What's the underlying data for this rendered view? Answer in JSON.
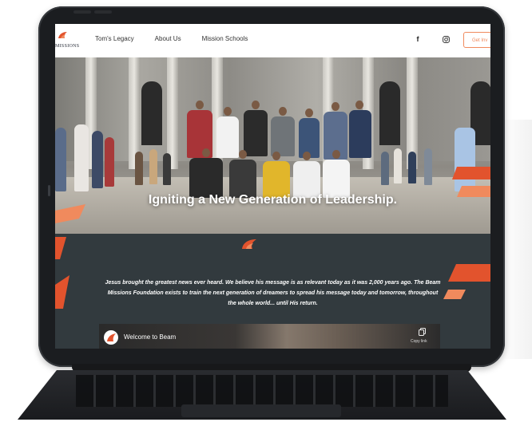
{
  "header": {
    "logo_text": "MISSIONS",
    "nav": [
      "Tom's Legacy",
      "About Us",
      "Mission Schools"
    ],
    "cta_label": "Get Inv"
  },
  "hero": {
    "title": "Igniting a New Generation of Leadership."
  },
  "mission": {
    "text": "Jesus brought the greatest news ever heard. We believe his message is as relevant today as it was 2,000 years ago. The Beam Missions Foundation exists to train the next generation of dreamers to spread his message today and tomorrow, throughout the whole world... until His return."
  },
  "video": {
    "title": "Welcome to Beam",
    "copy_label": "Copy link"
  },
  "icons": {
    "facebook": "f",
    "instagram": "instagram-icon",
    "brand": "beam-flame-icon",
    "copy": "copy-icon"
  },
  "colors": {
    "accent": "#f08a5d",
    "accent_dark": "#e2532d",
    "section_bg": "#323a3e"
  }
}
